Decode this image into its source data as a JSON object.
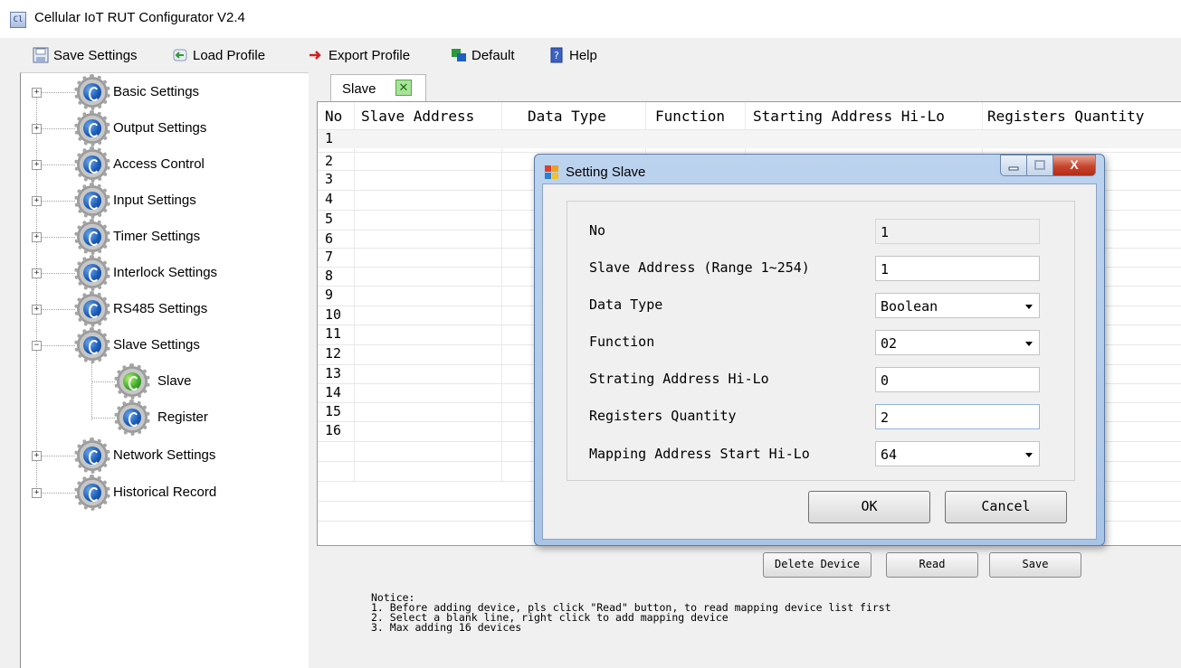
{
  "window": {
    "title": "Cellular IoT RUT Configurator V2.4",
    "icon_text": "Cl"
  },
  "toolbar": {
    "save_settings": "Save Settings",
    "load_profile": "Load Profile",
    "export_profile": "Export Profile",
    "default": "Default",
    "help": "Help"
  },
  "sidebar": {
    "items": [
      {
        "label": "Basic Settings",
        "expander": "+"
      },
      {
        "label": "Output Settings",
        "expander": "+"
      },
      {
        "label": "Access Control",
        "expander": "+"
      },
      {
        "label": "Input Settings",
        "expander": "+"
      },
      {
        "label": "Timer Settings",
        "expander": "+"
      },
      {
        "label": "Interlock Settings",
        "expander": "+"
      },
      {
        "label": "RS485 Settings",
        "expander": "+"
      },
      {
        "label": "Slave Settings",
        "expander": "−"
      },
      {
        "label": "Slave"
      },
      {
        "label": "Register"
      },
      {
        "label": "Network Settings",
        "expander": "+"
      },
      {
        "label": "Historical Record",
        "expander": "+"
      }
    ]
  },
  "tab": {
    "label": "Slave",
    "close_glyph": "✕"
  },
  "grid": {
    "headers": [
      "No",
      "Slave Address",
      "Data Type",
      "Function",
      "Starting Address Hi-Lo",
      "Registers Quantity"
    ],
    "rows": [
      "1",
      "2",
      "3",
      "4",
      "5",
      "6",
      "7",
      "8",
      "9",
      "10",
      "11",
      "12",
      "13",
      "14",
      "15",
      "16"
    ]
  },
  "buttons": {
    "delete_device": "Delete Device",
    "read": "Read",
    "save": "Save"
  },
  "notice": {
    "title": "Notice:",
    "line1": "1. Before adding device, pls click \"Read\" button, to read mapping device list first",
    "line2": "2. Select a blank line, right click to add mapping device",
    "line3": "3. Max adding 16 devices"
  },
  "dialog": {
    "title": "Setting Slave",
    "close_glyph": "X",
    "fields": {
      "no_label": "No",
      "no_value": "1",
      "slave_address_label": "Slave Address (Range 1~254)",
      "slave_address_value": "1",
      "data_type_label": "Data Type",
      "data_type_value": "Boolean",
      "function_label": "Function",
      "function_value": "02",
      "starting_address_label": "Strating Address Hi-Lo",
      "starting_address_value": "0",
      "registers_quantity_label": "Registers Quantity",
      "registers_quantity_value": "2",
      "mapping_address_label": "Mapping Address Start Hi-Lo",
      "mapping_address_value": "64"
    },
    "ok": "OK",
    "cancel": "Cancel"
  },
  "colors": {
    "dialog_frame": "#a8c4e6",
    "close_button": "#c7462e",
    "tree_ball": "#1a5cb8"
  }
}
